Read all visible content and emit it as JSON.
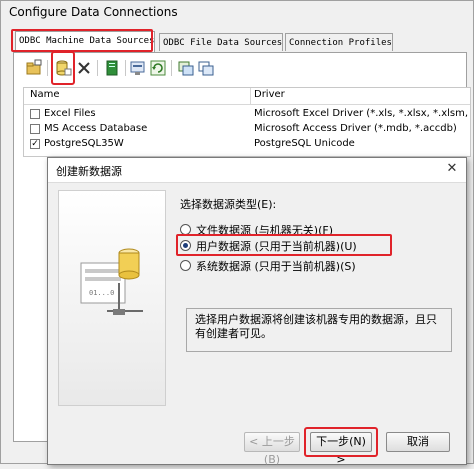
{
  "window": {
    "title": "Configure Data Connections"
  },
  "tabs": [
    {
      "label": "ODBC Machine Data Sources"
    },
    {
      "label": "ODBC File Data Sources"
    },
    {
      "label": "Connection Profiles"
    }
  ],
  "list": {
    "headers": {
      "name": "Name",
      "driver": "Driver"
    },
    "rows": [
      {
        "name": "Excel Files",
        "driver": "Microsoft Excel Driver (*.xls, *.xlsx, *.xlsm, *.xlsb)",
        "checked": false
      },
      {
        "name": "MS Access Database",
        "driver": "Microsoft Access Driver (*.mdb, *.accdb)",
        "checked": false
      },
      {
        "name": "PostgreSQL35W",
        "driver": "PostgreSQL Unicode",
        "checked": true
      }
    ]
  },
  "dialog": {
    "title": "创建新数据源",
    "prompt": "选择数据源类型(E):",
    "options": [
      {
        "label": "文件数据源 (与机器无关)(F)",
        "selected": false
      },
      {
        "label": "用户数据源 (只用于当前机器)(U)",
        "selected": true
      },
      {
        "label": "系统数据源 (只用于当前机器)(S)",
        "selected": false
      }
    ],
    "description": "选择用户数据源将创建该机器专用的数据源，且只有创建者可见。",
    "buttons": {
      "back": "< 上一步(B)",
      "next": "下一步(N) >",
      "cancel": "取消"
    },
    "close_symbol": "✕"
  },
  "colors": {
    "highlight": "#e0232a",
    "window_bg": "#f0f0f0"
  },
  "icons": [
    "open-folder-icon",
    "database-add-icon",
    "delete-icon",
    "script-icon",
    "config-icon",
    "refresh-icon",
    "connect-icon",
    "copy-icon",
    "database-server-icon"
  ]
}
